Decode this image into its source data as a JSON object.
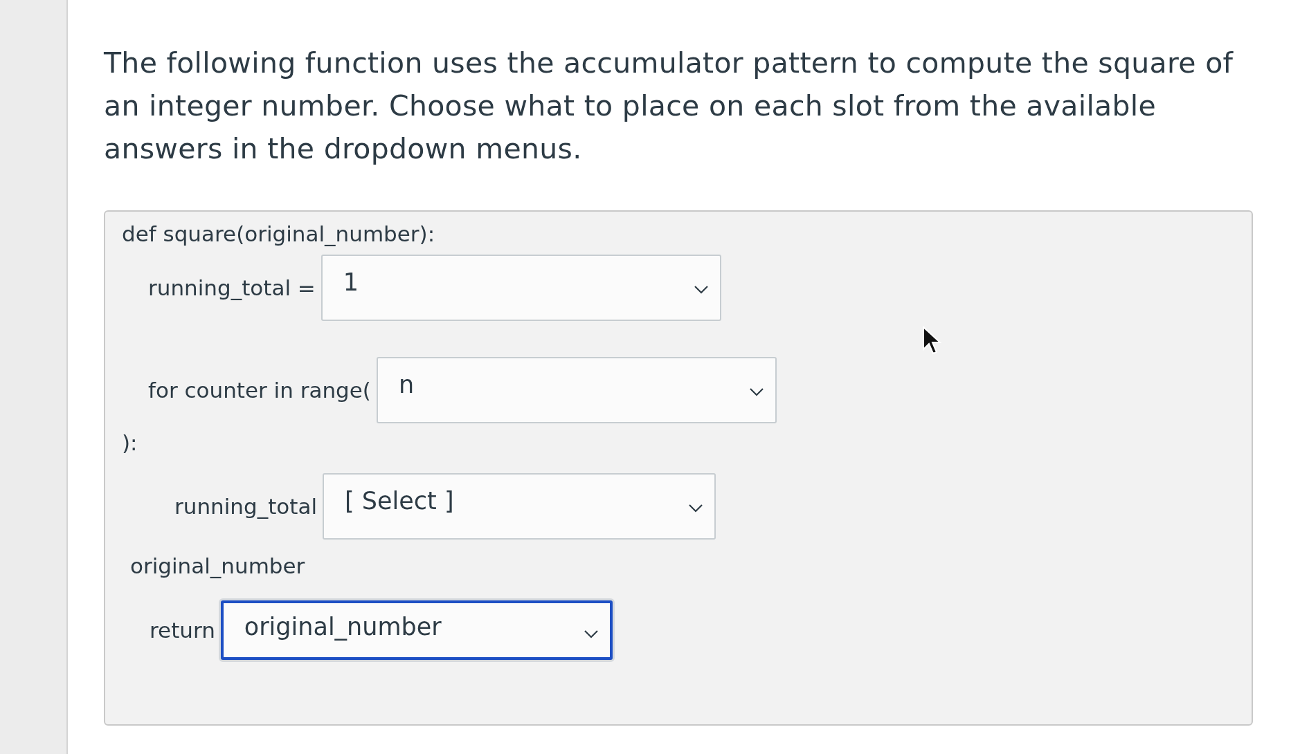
{
  "question": "The following function uses the accumulator pattern to compute the square of an integer number. Choose what to place on each slot from the available answers in the dropdown menus.",
  "code_lines": [
    {
      "kind": "text",
      "text": "def square(original_number):"
    },
    {
      "kind": "select",
      "label": "running_total =",
      "value": "1",
      "focused": false
    },
    {
      "kind": "select",
      "label": "for counter in range(",
      "value": "n",
      "focused": false
    },
    {
      "kind": "text",
      "text": "):"
    },
    {
      "kind": "select",
      "label": "running_total",
      "value": "[ Select ]",
      "focused": false
    },
    {
      "kind": "text",
      "text": "original_number"
    },
    {
      "kind": "select",
      "label": "return",
      "value": "original_number",
      "focused": true
    }
  ]
}
